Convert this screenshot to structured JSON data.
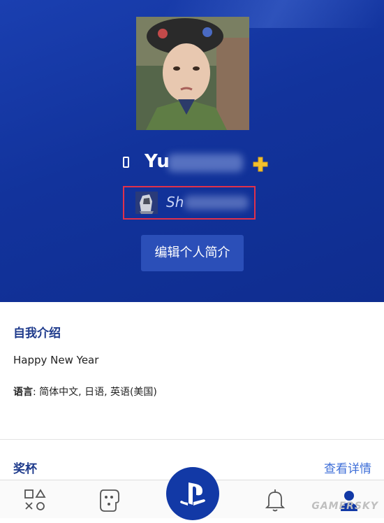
{
  "profile": {
    "online_id_prefix": "Yu",
    "nickname_prefix": "Sh",
    "edit_button": "编辑个人简介"
  },
  "about": {
    "title": "自我介绍",
    "bio": "Happy New Year",
    "language_label": "语言",
    "languages": "简体中文, 日语, 英语(美国)"
  },
  "trophies": {
    "title": "奖杯",
    "link": "查看详情"
  },
  "nav": {
    "items": [
      "games-icon",
      "social-icon",
      "playstation-icon",
      "bell-icon",
      "profile-icon"
    ]
  },
  "watermark": "GAMERSKY",
  "colors": {
    "header_bg": "#12339c",
    "accent": "#1f3b8c",
    "link": "#3f6fd8",
    "highlight_box": "#e0314b"
  }
}
